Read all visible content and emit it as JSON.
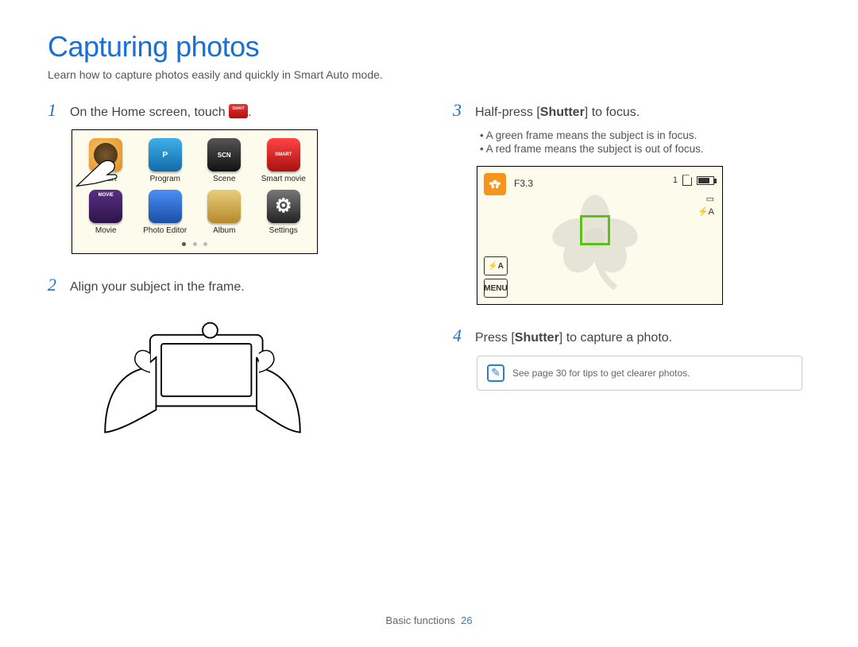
{
  "title": "Capturing photos",
  "subtitle": "Learn how to capture photos easily and quickly in Smart Auto mode.",
  "steps": {
    "s1_pre": "On the Home screen, touch ",
    "s1_post": ".",
    "s2": "Align your subject in the frame.",
    "s3_pre": "Half-press [",
    "s3_bold": "Shutter",
    "s3_post": "] to focus.",
    "s3_bullets": {
      "b1": "A green frame means the subject is in focus.",
      "b2": "A red frame means the subject is out of focus."
    },
    "s4_pre": "Press [",
    "s4_bold": "Shutter",
    "s4_post": "] to capture a photo."
  },
  "step_nums": {
    "n1": "1",
    "n2": "2",
    "n3": "3",
    "n4": "4"
  },
  "home_icons": {
    "smart": "Smart",
    "program": "Program",
    "program_letter": "P",
    "scene": "Scene",
    "scene_letter": "SCN",
    "smartmovie": "Smart movie",
    "smartmovie_letter": "SMART",
    "movie": "Movie",
    "photoeditor": "Photo Editor",
    "album": "Album",
    "settings": "Settings"
  },
  "viewfinder": {
    "fnumber": "F3.3",
    "count": "1",
    "flash_label": "⚡A",
    "menu_label": "MENU",
    "right_icon1": "▭",
    "right_icon2": "⚡A"
  },
  "tip": "See page 30 for tips to get clearer photos.",
  "footer": {
    "section": "Basic functions",
    "page": "26"
  }
}
